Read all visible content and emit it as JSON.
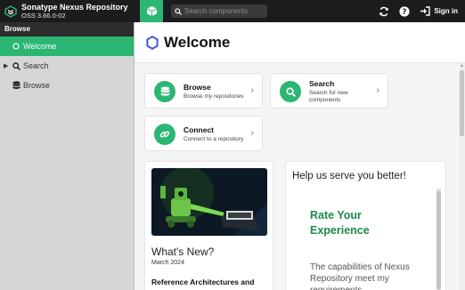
{
  "app": {
    "name": "Sonatype Nexus Repository",
    "version": "OSS 3.66.0-02"
  },
  "toolbar": {
    "search_placeholder": "Search components",
    "sign_in_label": "Sign in",
    "icons": [
      "cube-icon",
      "search-icon",
      "refresh-icon",
      "help-icon",
      "sign-in-icon"
    ]
  },
  "sidebar": {
    "header": "Browse",
    "items": [
      {
        "label": "Welcome",
        "icon": "circle-outline-icon",
        "active": true
      },
      {
        "label": "Search",
        "icon": "search-icon",
        "expandable": true
      },
      {
        "label": "Browse",
        "icon": "database-icon"
      }
    ]
  },
  "main": {
    "title": "Welcome",
    "cards": [
      {
        "title": "Browse",
        "description": "Browse my repositories",
        "icon": "database-icon"
      },
      {
        "title": "Search",
        "description": "Search for new components",
        "icon": "search-icon"
      },
      {
        "title": "Connect",
        "description": "Connect to a repository",
        "icon": "link-icon"
      }
    ],
    "news": {
      "title": "What's New?",
      "date": "March 2024",
      "link": "Reference Architectures and"
    },
    "help": {
      "title": "Help us serve you better!",
      "survey_heading": "Rate Your Experience",
      "survey_text": "The capabilities of Nexus Repository meet my requirements"
    }
  },
  "colors": {
    "accent": "#2bb673",
    "topbar": "#1c1c1e",
    "sidebar": "#d6d6d6"
  }
}
